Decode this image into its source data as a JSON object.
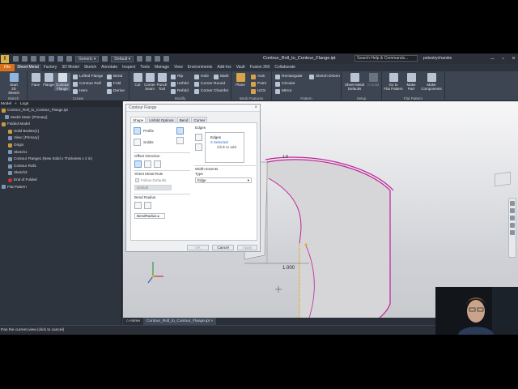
{
  "titlebar": {
    "qat_profile": "Generic",
    "qat_appearance": "Default",
    "doc_title": "Contour_Roll_to_Contour_Flange.ipt",
    "search_placeholder": "Search Help & Commands...",
    "user": "petestrycharske"
  },
  "tabs": [
    "File",
    "Sheet Metal",
    "Factory",
    "3D Model",
    "Sketch",
    "Annotate",
    "Inspect",
    "Tools",
    "Manage",
    "View",
    "Environments",
    "Add-Ins",
    "Vault",
    "Fusion 360",
    "Collaborate"
  ],
  "active_tab": "Sheet Metal",
  "ribbon": {
    "sketch": {
      "label": "Sketch",
      "start": "Start\n2D Sketch"
    },
    "create": {
      "label": "Create",
      "face": "Face",
      "flange": "Flange",
      "contour_flange": "Contour\nFlange",
      "lofted_flange": "Lofted Flange",
      "contour_roll": "Contour Roll",
      "hem": "Hem",
      "bend": "Bend",
      "fold": "Fold",
      "derive": "Derive"
    },
    "modify": {
      "label": "Modify",
      "cut": "Cut",
      "corner_seam": "Corner\nSeam",
      "punch_tool": "Punch\nTool",
      "rip": "Rip",
      "unfold": "Unfold",
      "refold": "Refold",
      "hole": "Hole",
      "corner_round": "Corner Round",
      "corner_chamfer": "Corner Chamfer",
      "mark": "Mark"
    },
    "work": {
      "label": "Work Features",
      "plane": "Plane",
      "axis": "Axis",
      "point": "Point",
      "ucs": "UCS"
    },
    "pattern": {
      "label": "Pattern",
      "rectangular": "Rectangular",
      "circular": "Circular",
      "mirror": "Mirror",
      "sketch_driven": "Sketch Driven"
    },
    "setup": {
      "label": "Setup",
      "defaults": "Sheet Metal\nDefaults",
      "asolid": "A-Solid"
    },
    "flat": {
      "label": "Flat Pattern",
      "goto": "Go to\nFlat Pattern",
      "make_part": "Make\nPart",
      "make_components": "Make\nComponents"
    }
  },
  "browser": {
    "header_model": "Model",
    "header_plus": "+",
    "header_search": "Logs",
    "items": [
      {
        "label": "Contour_Roll_to_Contour_Flange.ipt",
        "color": "#c89a3c"
      },
      {
        "label": "Model State: [Primary]",
        "color": "#7e95b3"
      },
      {
        "label": "Folded Model",
        "color": "#c89a3c"
      },
      {
        "label": "Solid Bodies(1)",
        "color": "#c89a3c"
      },
      {
        "label": "View: [Primary]",
        "color": "#7e95b3"
      },
      {
        "label": "Origin",
        "color": "#c89a3c"
      },
      {
        "label": "Sketch1",
        "color": "#7e95b3"
      },
      {
        "label": "Contour Flange1 (New Solid x Thickness x 2 in)",
        "color": "#7e95b3"
      },
      {
        "label": "Contour Roll1",
        "color": "#7e95b3"
      },
      {
        "label": "Sketch3",
        "color": "#7e95b3"
      },
      {
        "label": "End of Folded",
        "color": "#cc3333"
      },
      {
        "label": "Flat Pattern",
        "color": "#7e95b3"
      }
    ]
  },
  "dialog": {
    "title": "Contour Flange",
    "tabs": [
      "Shape",
      "Unfold Options",
      "Bend",
      "Corner"
    ],
    "profile_label": "Profile",
    "solids_label": "Solids",
    "edges_label": "Edges",
    "edges_list_header": "Edges",
    "edges_selected": "0 Selected",
    "edges_click": "Click to add",
    "offset_direction": "Offset Direction",
    "sheet_metal_rule": "Sheet Metal Rule",
    "follow_defaults": "Follow Defaults",
    "rule_value": "Default",
    "bend_radius": "Bend Radius",
    "bend_radius_value": "BendRadius",
    "width_extents": "Width Extents",
    "type_label": "Type",
    "type_value": "Edge",
    "ok": "OK",
    "cancel": "Cancel",
    "apply": "Apply"
  },
  "viewport": {
    "dimension": "1.000",
    "dimension_top": "1.0"
  },
  "doc_tabs": {
    "home": "Home",
    "file": "Contour_Roll_to_Contour_Flange.ipt"
  },
  "status": "Pan the current view (click to cancel)",
  "colors": {
    "accent": "#d9701c",
    "highlight": "#c0249a",
    "selection": "#e3b02a"
  }
}
